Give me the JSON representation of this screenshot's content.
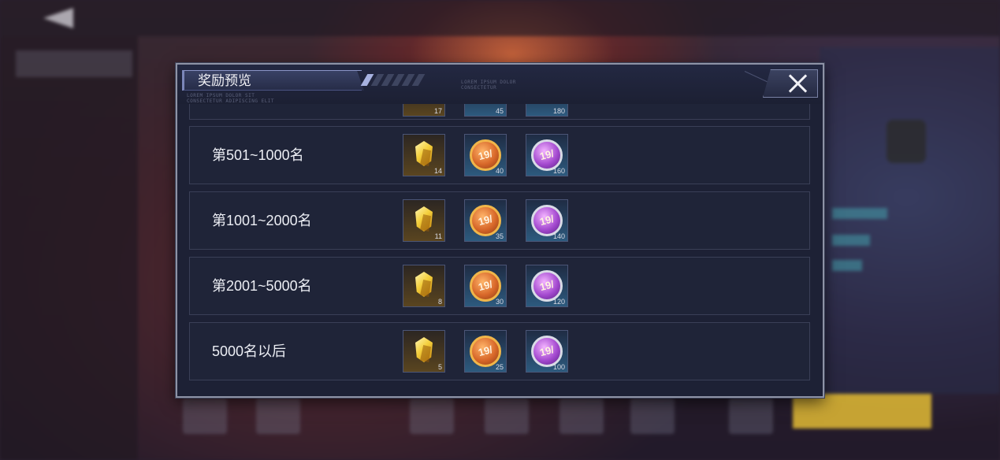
{
  "background": {
    "sidebar_items": [
      "",
      "",
      "",
      ""
    ]
  },
  "dialog": {
    "title": "奖励预览",
    "header_small_text": [
      "LOREM IPSUM DOLOR",
      "CONSECTETUR"
    ],
    "subtitle_small_text": [
      "LOREM IPSUM DOLOR SIT",
      "CONSECTETUR ADIPISCING ELIT",
      "LOREM IPSUM DOLOR"
    ],
    "close_label": "close"
  },
  "rewards": {
    "partial_row": {
      "counts": [
        "17",
        "45",
        "180"
      ]
    },
    "rows": [
      {
        "label": "第501~1000名",
        "counts": [
          "14",
          "40",
          "160"
        ]
      },
      {
        "label": "第1001~2000名",
        "counts": [
          "11",
          "35",
          "140"
        ]
      },
      {
        "label": "第2001~5000名",
        "counts": [
          "8",
          "30",
          "120"
        ]
      },
      {
        "label": "5000名以后",
        "counts": [
          "5",
          "25",
          "100"
        ]
      }
    ],
    "item_icons": [
      "gold-crystal-icon",
      "orange-medal-icon",
      "purple-medal-icon"
    ]
  },
  "colors": {
    "dialog_bg": "#1d2135",
    "row_bg": "#1f2438",
    "border": "#8e93a6",
    "accent": "#a7b2e0"
  }
}
